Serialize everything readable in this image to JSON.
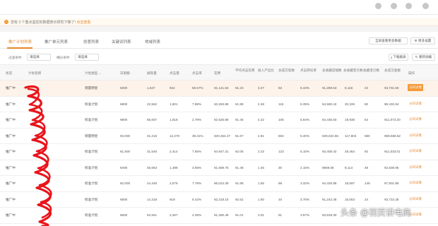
{
  "notice": {
    "text": "您有 3 个重点监控的数据表示研究下降了!",
    "link": "点击查看"
  },
  "tabs": [
    {
      "label": "推广计划列表",
      "active": true
    },
    {
      "label": "推广单元列表",
      "active": false
    },
    {
      "label": "创意列表",
      "active": false
    },
    {
      "label": "关键词列表",
      "active": false
    },
    {
      "label": "地域列表",
      "active": false
    }
  ],
  "toolbar": {
    "fullscreen_label": "全屏查看更多数据",
    "more_label": "更多设置",
    "export_label": "下载报表",
    "reset_label": "重新加载"
  },
  "filters": {
    "filter1_label": "过滤条件:",
    "filter1_value": "请选择",
    "filter2_label": "细分条件:",
    "filter2_value": "请选择"
  },
  "table": {
    "headers": [
      "状态",
      "计划名称",
      "计划类型",
      "日限额",
      "展现量",
      "点击量",
      "点击率",
      "花费",
      "平均点击花费",
      "投入产出比",
      "总成交笔数",
      "点击转化率",
      "总收藏店铺数",
      "总收藏宝贝数",
      "收藏宝贝数",
      "总成交金额",
      "操作"
    ],
    "type_filter_label": "计划类型",
    "rows": [
      {
        "status": "推广中",
        "type": "销量明星",
        "budget": "¥300",
        "impr": "1,637",
        "clicks": "924",
        "ctr": "56.57%",
        "cost": "¥1,141.63",
        "cpc": "¥1.23",
        "roi": "3.27",
        "orders": "63",
        "cvr": "6.43%",
        "shop_fav": "¥1,289.53",
        "item_fav": "8,116",
        "fav2": "24",
        "gmv": "¥3,731.50",
        "action": "分日详情",
        "highlight": true
      },
      {
        "status": "推广中",
        "type": "标准计划",
        "budget": "¥800",
        "impr": "22,562",
        "clicks": "1,801",
        "ctr": "7.98%",
        "cost": "¥3,283.88",
        "cpc": "¥1.88",
        "roi": "2.48",
        "orders": "115",
        "cvr": "6.39%",
        "shop_fav": "¥4,590.42",
        "item_fav": "20,326",
        "fav2": "60",
        "gmv": "¥8,432.64",
        "action": "分日详情",
        "highlight": false
      },
      {
        "status": "推广中",
        "type": "标准计划",
        "budget": "¥800",
        "impr": "65,607",
        "clicks": "1,818",
        "ctr": "2.79%",
        "cost": "¥2,626.86",
        "cpc": "¥1.45",
        "roi": "4.22",
        "orders": "106",
        "cvr": "5.84%",
        "shop_fav": "¥4,435.60",
        "item_fav": "19,938",
        "fav2": "54",
        "gmv": "¥11,073.20",
        "action": "分日详情",
        "highlight": false
      },
      {
        "status": "推广中",
        "type": "销量明星",
        "budget": "¥3,000",
        "impr": "31,216",
        "clicks": "12,270",
        "ctr": "39.31%",
        "cost": "¥20,454.27",
        "cpc": "¥1.67",
        "roi": "2.81",
        "orders": "663",
        "cvr": "5.40%",
        "shop_fav": "¥29,024.66",
        "item_fav": "117,803",
        "fav2": "580",
        "gmv": "¥59,568.62",
        "action": "分日详情",
        "highlight": false
      },
      {
        "status": "推广中",
        "type": "标准计划",
        "budget": "¥1,500",
        "impr": "31,546",
        "clicks": "2,414",
        "ctr": "7.65%",
        "cost": "¥4,947.31",
        "cpc": "¥2.05",
        "roi": "2.23",
        "orders": "123",
        "cvr": "5.10%",
        "shop_fav": "¥3,406.42",
        "item_fav": "28,464",
        "fav2": "92",
        "gmv": "¥11,033.01",
        "action": "分日详情",
        "highlight": false
      },
      {
        "status": "推广中",
        "type": "标准计划",
        "budget": "¥400",
        "impr": "45,663",
        "clicks": "1,398",
        "ctr": "3.06%",
        "cost": "¥1,659.75",
        "cpc": "¥1.48",
        "roi": "1.45",
        "orders": "30",
        "cvr": "2.15%",
        "shop_fav": "¥859.06",
        "item_fav": "8,114",
        "fav2": "48",
        "gmv": "¥2,838.95",
        "action": "分日详情",
        "highlight": false
      },
      {
        "status": "推广中",
        "type": "标准计划",
        "budget": "¥2,000",
        "impr": "24,448",
        "clicks": "2,679",
        "ctr": "7.78%",
        "cost": "¥5,024.39",
        "cpc": "¥1.88",
        "roi": "1.55",
        "orders": "89",
        "cvr": "3.32%",
        "shop_fav": "¥4,425.88",
        "item_fav": "18,597",
        "fav2": "149",
        "gmv": "¥7,801.89",
        "action": "分日详情",
        "highlight": false
      },
      {
        "status": "推广中",
        "type": "标准计划",
        "budget": "¥500",
        "impr": "14,318",
        "clicks": "919",
        "ctr": "6.42%",
        "cost": "¥2,318.10",
        "cpc": "¥2.52",
        "roi": "1.60",
        "orders": "34",
        "cvr": "3.70%",
        "shop_fav": "¥1,242.35",
        "item_fav": "15,053",
        "fav2": "24",
        "gmv": "¥3,722.28",
        "action": "分日详情",
        "highlight": false
      },
      {
        "status": "推广中",
        "type": "标准计划",
        "budget": "¥600",
        "impr": "94,941",
        "clicks": "2,267",
        "ctr": "2.39%",
        "cost": "¥1,280.49",
        "cpc": "¥1.01",
        "roi": "3.01",
        "orders": "81",
        "cvr": "3.57%",
        "shop_fav": "¥3,818.30",
        "item_fav": "",
        "fav2": "",
        "gmv": "",
        "action": "分日详情",
        "highlight": false
      }
    ]
  },
  "watermark": "头条 @羽页讲电商",
  "colors": {
    "accent": "#e8872a",
    "button": "#f39a3c",
    "scribble": "#e8141b"
  }
}
